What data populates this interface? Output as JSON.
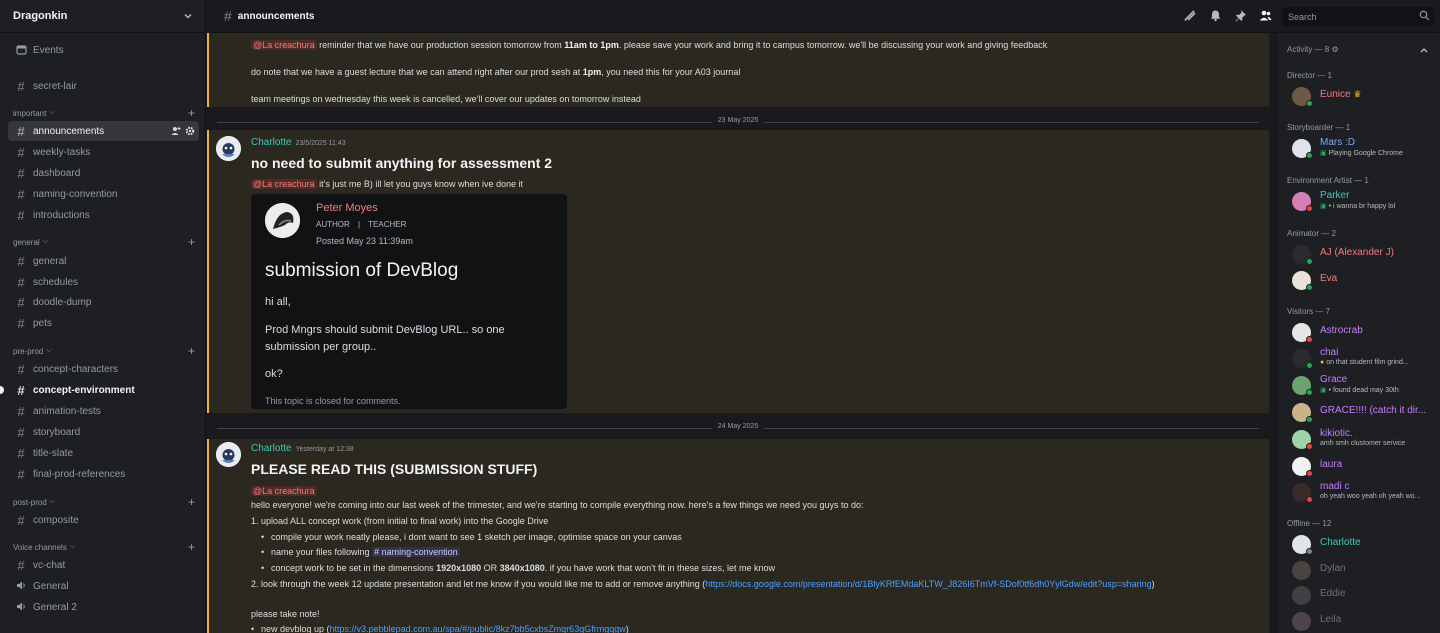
{
  "server": {
    "name": "Dragonkin"
  },
  "sidebar": {
    "events_label": "Events",
    "top_channels": [
      {
        "label": "secret-lair"
      }
    ],
    "categories": {
      "important": {
        "label": "important",
        "channels": [
          {
            "label": "announcements"
          },
          {
            "label": "weekly-tasks"
          },
          {
            "label": "dashboard"
          },
          {
            "label": "naming-convention"
          },
          {
            "label": "introductions"
          }
        ]
      },
      "general": {
        "label": "general",
        "channels": [
          {
            "label": "general"
          },
          {
            "label": "schedules"
          },
          {
            "label": "doodle-dump"
          },
          {
            "label": "pets"
          }
        ]
      },
      "preprod": {
        "label": "pre-prod",
        "channels": [
          {
            "label": "concept-characters"
          },
          {
            "label": "concept-environment"
          },
          {
            "label": "animation-tests"
          },
          {
            "label": "storyboard"
          },
          {
            "label": "title-slate"
          },
          {
            "label": "final-prod-references"
          }
        ]
      },
      "postprod": {
        "label": "post-prod",
        "channels": [
          {
            "label": "composite"
          }
        ]
      },
      "voice": {
        "label": "Voice channels",
        "channels": [
          {
            "label": "vc-chat"
          },
          {
            "label": "General"
          },
          {
            "label": "General 2"
          }
        ]
      }
    }
  },
  "topbar": {
    "channel": "announcements",
    "search_placeholder": "Search"
  },
  "chat": {
    "msg0": {
      "mention": "@La creachura",
      "line1_a": " reminder that we have our production session tomorrow from ",
      "line1_b": "11am to 1pm",
      "line1_c": ". please save your work and bring it to campus tomorrow. we'll be discussing your work and giving feedback",
      "line2_a": "do note that we have a guest lecture that we can attend right after our prod sesh at ",
      "line2_b": "1pm",
      "line2_c": ", you need this for your A03 journal",
      "line3": "team meetings on wednesday this week is cancelled, we'll cover our updates on tomorrow instead"
    },
    "divider1": "23 May 2025",
    "msg1": {
      "author": "Charlotte",
      "timestamp": "23/5/2025 11:43",
      "heading": "no need to submit anything for assessment 2",
      "mention": "@La creachura",
      "text": " it's just me B) ill let you guys know when ive done it"
    },
    "embed": {
      "name": "Peter Moyes",
      "role_a": "AUTHOR",
      "role_sep": "|",
      "role_b": "TEACHER",
      "posted": "Posted May 23 11:39am",
      "title": "submission of DevBlog",
      "p1": "hi all,",
      "p2a": "Prod Mngrs should submit DevBlog URL.. so one",
      "p2b": "submission per group..",
      "p3": "ok?",
      "footer": "This topic is closed for comments."
    },
    "divider2": "24 May 2025",
    "msg2": {
      "author": "Charlotte",
      "timestamp": "Yesterday at 12:38",
      "heading": "PLEASE READ THIS (SUBMISSION STUFF)",
      "mention": "@La creachura",
      "intro": "hello everyone! we're coming into our last week of the trimester, and we're starting to compile everything now. here's a few things we need you guys to do:",
      "item1": "1. upload ALL concept work (from initial to final work) into the Google Drive",
      "sub1": "compile your work neatly please, i dont want to see 1 sketch per image, optimise space on your canvas",
      "sub2_a": "name your files following ",
      "sub2_mention": "# naming-convention",
      "sub3_a": "concept work to be set in the dimensions ",
      "sub3_b": "1920x1080",
      "sub3_c": " OR ",
      "sub3_d": "3840x1080",
      "sub3_e": ". if you have work that won't fit in these sizes, let me know",
      "item2_a": "2. look through the week 12 update presentation and let me know if you would like me to add or remove anything (",
      "item2_link": "https://docs.google.com/presentation/d/1BlyKRfEMdaKLTW_J826I6TmVf-SDof0tf6dh0YylGdw/edit?usp=sharing",
      "item2_c": ")",
      "note": "please take note!",
      "note_item_a": "new devblog up (",
      "note_item_link": "https://v3.pebblepad.com.au/spa/#/public/8kz7bb5cxbsZmqr63gGfrmgqgw",
      "note_item_c": ")"
    }
  },
  "members": {
    "activity": "Activity — 8",
    "groups": {
      "director": {
        "label": "Director — 1",
        "members": [
          {
            "name": "Eunice",
            "badge": "♛"
          }
        ]
      },
      "storyboarder": {
        "label": "Storyboarder — 1",
        "members": [
          {
            "name": "Mars :D",
            "status": "Playing Google Chrome"
          }
        ]
      },
      "env": {
        "label": "Environment Artist — 1",
        "members": [
          {
            "name": "Parker",
            "status": "• i wanna br happy lol"
          }
        ]
      },
      "animator": {
        "label": "Animator — 2",
        "members": [
          {
            "name": "AJ (Alexander J)"
          },
          {
            "name": "Eva"
          }
        ]
      },
      "visitors": {
        "label": "Visitors — 7",
        "members": [
          {
            "name": "Astrocrab"
          },
          {
            "name": "chai",
            "status": "on that student film grind..."
          },
          {
            "name": "Grace",
            "status": "• found dead may 30th"
          },
          {
            "name": "GRACE!!!! (catch it dir..."
          },
          {
            "name": "kikiotic.",
            "status": "amh smh clustomer service"
          },
          {
            "name": "laura"
          },
          {
            "name": "madi c",
            "status": "oh yeah woo yeah oh yeah wo..."
          }
        ]
      },
      "offline": {
        "label": "Offline — 12",
        "members": [
          {
            "name": "Charlotte"
          },
          {
            "name": "Dylan"
          },
          {
            "name": "Eddie"
          },
          {
            "name": "Leila"
          }
        ]
      }
    }
  },
  "colors": {
    "accent_teal": "#3ec9b9",
    "mention_red": "#f47b7e",
    "highlight_border": "#f0b232",
    "link_blue": "#4ea0ff",
    "online": "#23a55a",
    "dnd": "#f23f43"
  }
}
